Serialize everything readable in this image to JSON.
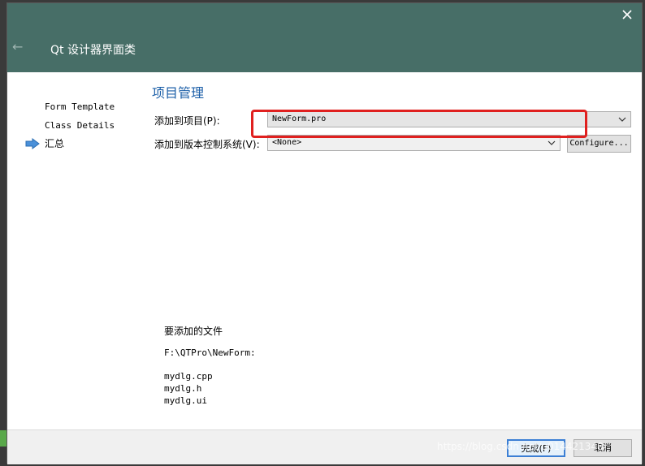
{
  "window": {
    "title": "Qt 设计器界面类",
    "back_icon": "back-arrow-icon",
    "close_icon": "close-icon"
  },
  "sidebar": {
    "items": [
      {
        "label": "Form Template"
      },
      {
        "label": "Class Details"
      },
      {
        "label": "汇总",
        "current": true
      }
    ],
    "current_icon": "arrow-right-icon"
  },
  "main": {
    "section_title": "项目管理",
    "add_to_project_label": "添加到项目(P):",
    "project_value": "NewForm.pro",
    "add_to_vcs_label": "添加到版本控制系统(V):",
    "vcs_value": "<None>",
    "configure_label": "Configure...",
    "files_title": "要添加的文件",
    "path": "F:\\QTPro\\NewForm:",
    "files": [
      "mydlg.cpp",
      "mydlg.h",
      "mydlg.ui"
    ]
  },
  "footer": {
    "finish_label": "完成(F)",
    "cancel_label": "取消"
  },
  "watermark": "https://blog.csdn.net/u014421348",
  "colors": {
    "titlebar": "#476e67",
    "section_title": "#1c5fa8",
    "highlight": "#e0201f"
  }
}
